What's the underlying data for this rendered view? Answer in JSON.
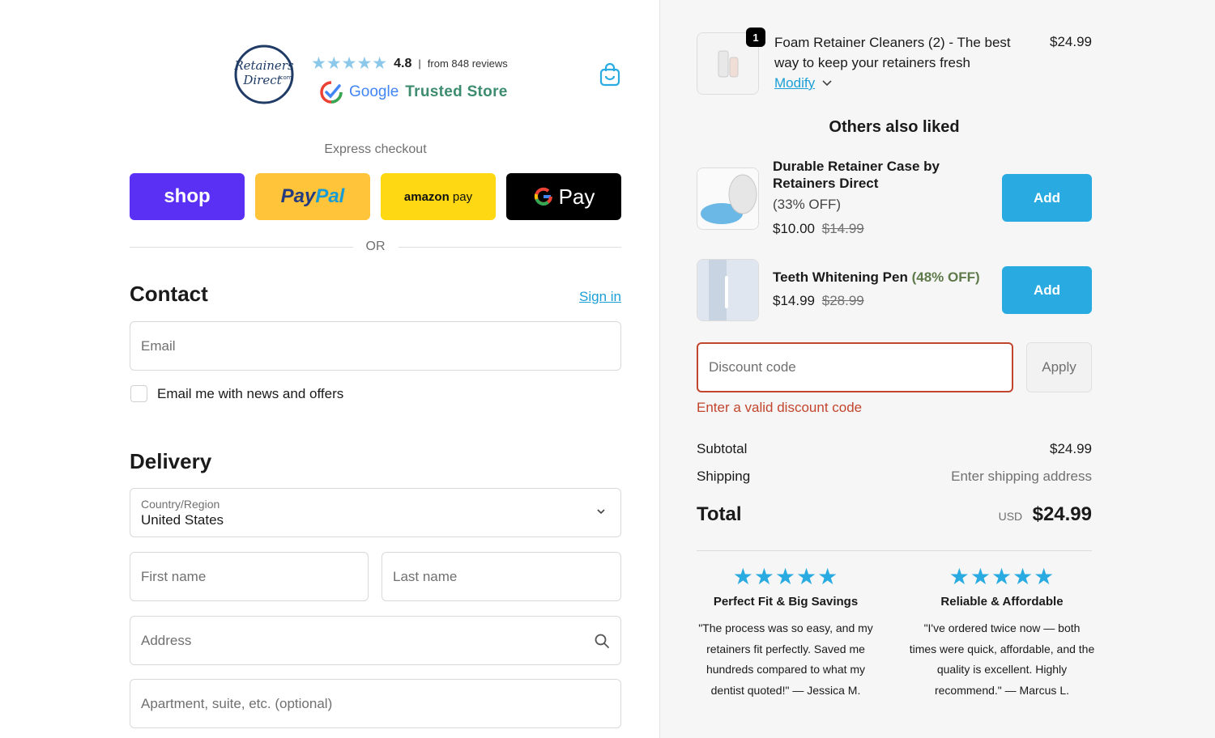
{
  "header": {
    "logo_text": "RetainersDirect.com",
    "rating": "4.8",
    "rating_separator": "|",
    "reviews_text": "from 848 reviews",
    "google_word": "Google",
    "trusted_text": "Trusted Store"
  },
  "express": {
    "label": "Express checkout",
    "shop": "shop",
    "paypal_pay": "Pay",
    "paypal_pal": "Pal",
    "amazon": "amazon",
    "amazon_pay": "pay",
    "gpay": "Pay",
    "or": "OR"
  },
  "contact": {
    "title": "Contact",
    "sign_in": "Sign in",
    "email_placeholder": "Email",
    "newsletter_label": "Email me with news and offers"
  },
  "delivery": {
    "title": "Delivery",
    "country_label": "Country/Region",
    "country_value": "United States",
    "first_name_placeholder": "First name",
    "last_name_placeholder": "Last name",
    "address_placeholder": "Address",
    "apartment_placeholder": "Apartment, suite, etc. (optional)"
  },
  "cart": {
    "item": {
      "quantity": "1",
      "name": "Foam Retainer Cleaners (2) - The best way to keep your retainers fresh",
      "price": "$24.99",
      "modify": "Modify"
    },
    "others_title": "Others also liked",
    "upsells": [
      {
        "name": "Durable Retainer Case by Retainers Direct",
        "off": "(33% OFF)",
        "price": "$10.00",
        "old_price": "$14.99",
        "button": "Add"
      },
      {
        "name": "Teeth Whitening Pen",
        "off": "(48% OFF)",
        "price": "$14.99",
        "old_price": "$28.99",
        "button": "Add"
      }
    ],
    "discount_placeholder": "Discount code",
    "apply": "Apply",
    "discount_error": "Enter a valid discount code",
    "subtotal_label": "Subtotal",
    "subtotal_value": "$24.99",
    "shipping_label": "Shipping",
    "shipping_value": "Enter shipping address",
    "total_label": "Total",
    "total_currency": "USD",
    "total_value": "$24.99"
  },
  "reviews": [
    {
      "stars": "★★★★★",
      "title": "Perfect Fit & Big Savings",
      "text": "\"The process was so easy, and my retainers fit perfectly. Saved me hundreds compared to what my dentist quoted!\" — Jessica M."
    },
    {
      "stars": "★★★★★",
      "title": "Reliable & Affordable",
      "text": "\"I've ordered twice now — both times were quick, affordable, and the quality is excellent. Highly recommend.\" — Marcus L."
    }
  ],
  "colors": {
    "accent": "#29abe2",
    "shop_purple": "#5a31f4",
    "paypal_yellow": "#ffc439",
    "amazon_yellow": "#ffd814",
    "error": "#c2452d",
    "trusted_green": "#3d8c6f"
  }
}
